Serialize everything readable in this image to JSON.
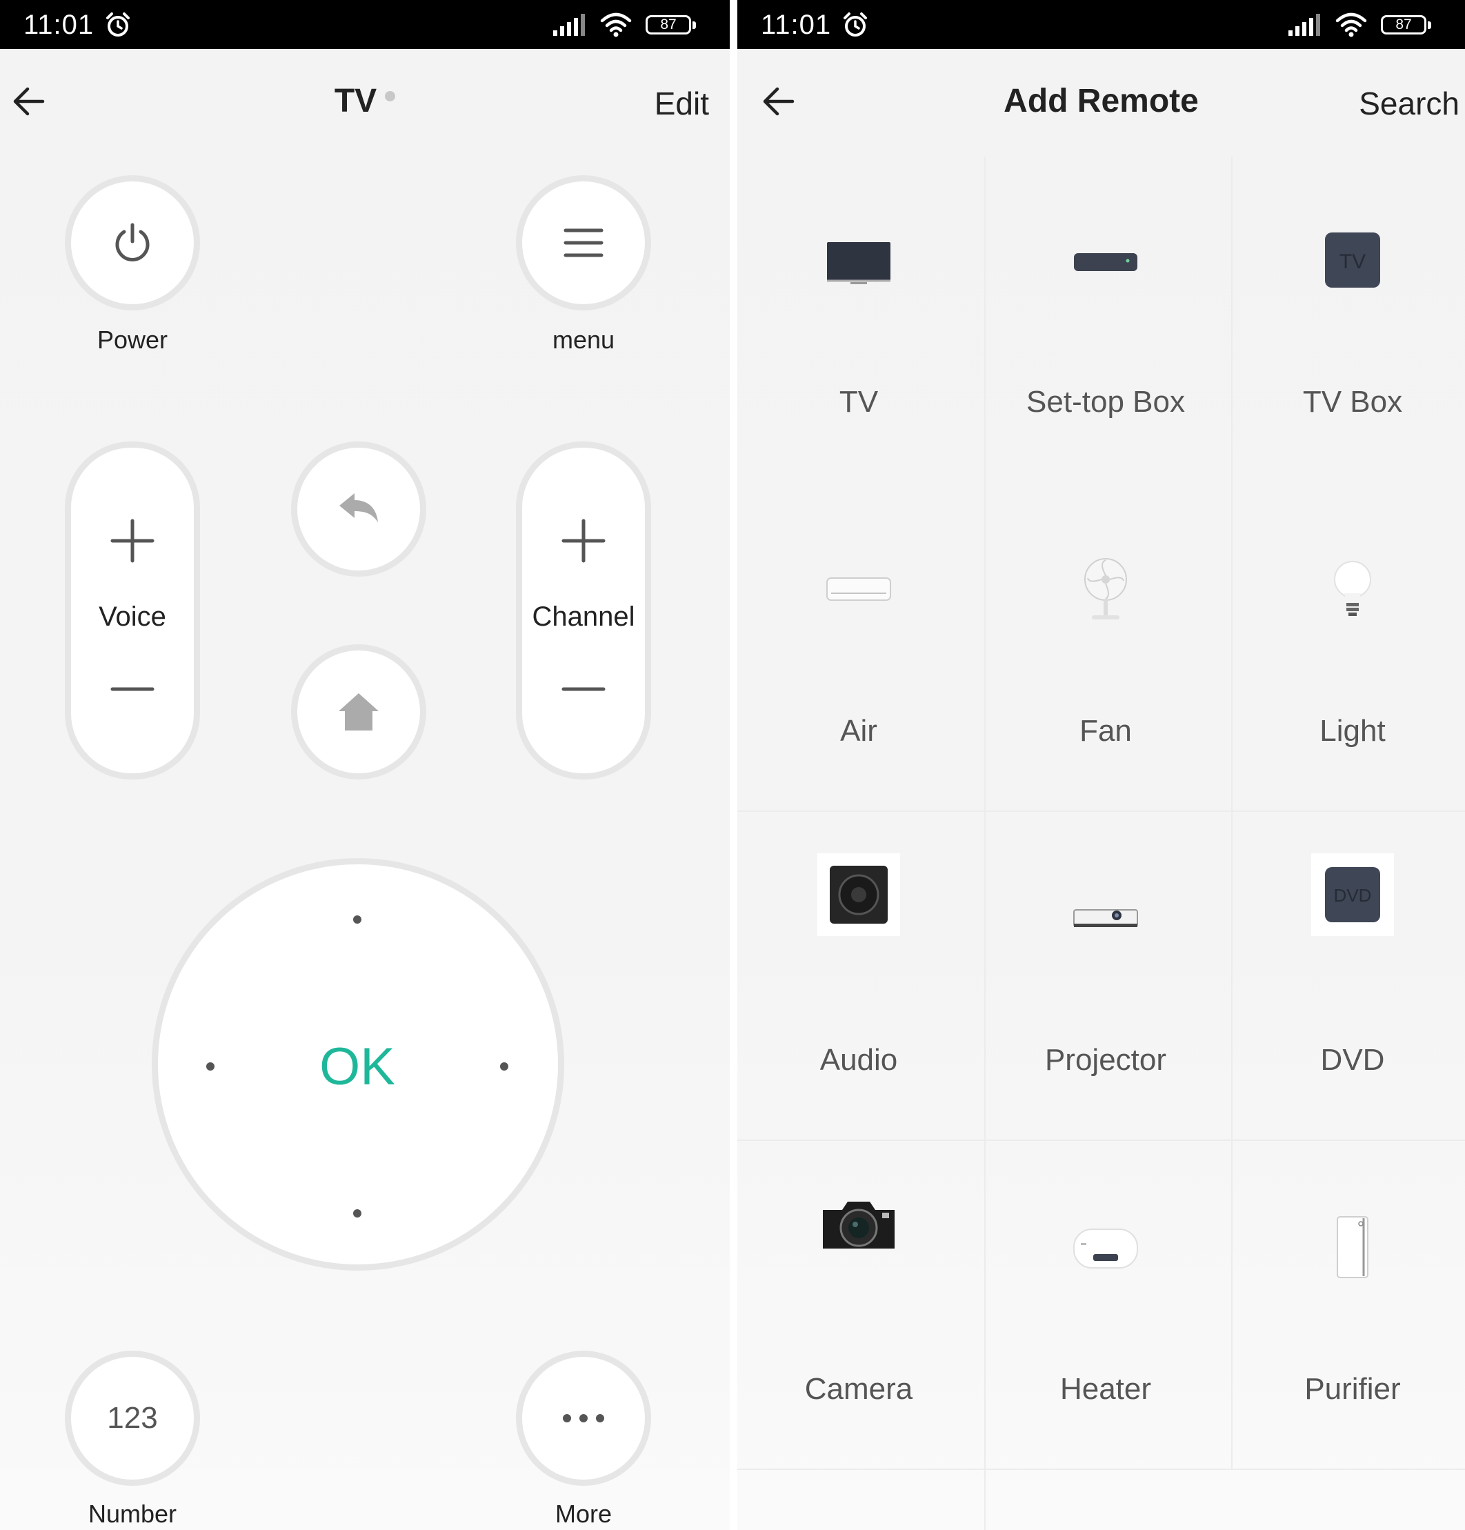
{
  "status_bar": {
    "time": "11:01",
    "battery": "87"
  },
  "remote": {
    "title": "TV",
    "edit_label": "Edit",
    "power_label": "Power",
    "menu_label": "menu",
    "voice_label": "Voice",
    "channel_label": "Channel",
    "ok_label": "OK",
    "number_button": "123",
    "number_label": "Number",
    "more_label": "More"
  },
  "add_remote": {
    "title": "Add Remote",
    "search_label": "Search",
    "icon_tv_text": "TV",
    "icon_dvd_text": "DVD",
    "devices": [
      {
        "label": "TV",
        "icon": "tv-icon"
      },
      {
        "label": "Set-top Box",
        "icon": "set-top-box-icon"
      },
      {
        "label": "TV Box",
        "icon": "tv-box-icon"
      },
      {
        "label": "Air",
        "icon": "air-conditioner-icon"
      },
      {
        "label": "Fan",
        "icon": "fan-icon"
      },
      {
        "label": "Light",
        "icon": "light-bulb-icon"
      },
      {
        "label": "Audio",
        "icon": "speaker-icon"
      },
      {
        "label": "Projector",
        "icon": "projector-icon"
      },
      {
        "label": "DVD",
        "icon": "dvd-icon"
      },
      {
        "label": "Camera",
        "icon": "camera-icon"
      },
      {
        "label": "Heater",
        "icon": "water-heater-icon"
      },
      {
        "label": "Purifier",
        "icon": "air-purifier-icon"
      }
    ]
  }
}
